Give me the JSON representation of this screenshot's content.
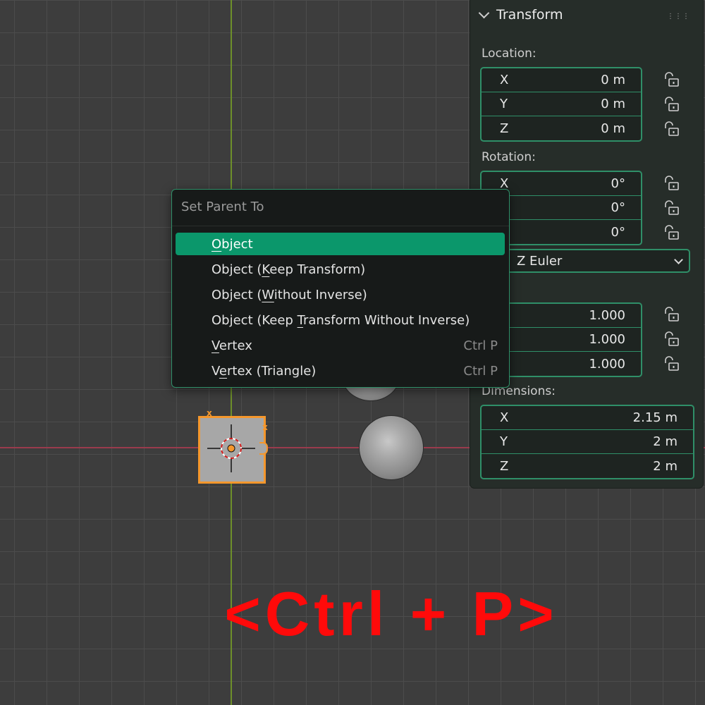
{
  "viewport": {
    "axis_colors": {
      "x": "#9a3b4d",
      "y": "#6d8f2a"
    },
    "selection_color": "#f5972c",
    "empty_marker_labels": [
      "x",
      "x"
    ]
  },
  "panel": {
    "title": "Transform",
    "location": {
      "label": "Location:",
      "rows": [
        {
          "axis": "X",
          "value": "0 m"
        },
        {
          "axis": "Y",
          "value": "0 m"
        },
        {
          "axis": "Z",
          "value": "0 m"
        }
      ]
    },
    "rotation": {
      "label": "Rotation:",
      "rows": [
        {
          "axis": "X",
          "value": "0°"
        },
        {
          "axis": "",
          "value": "0°"
        },
        {
          "axis": "",
          "value": "0°"
        }
      ],
      "mode": "Z Euler"
    },
    "scale": {
      "label": "e:",
      "rows": [
        {
          "axis": "",
          "value": "1.000"
        },
        {
          "axis": "",
          "value": "1.000"
        },
        {
          "axis": "",
          "value": "1.000"
        }
      ]
    },
    "dimensions": {
      "label": "Dimensions:",
      "rows": [
        {
          "axis": "X",
          "value": "2.15 m"
        },
        {
          "axis": "Y",
          "value": "2 m"
        },
        {
          "axis": "Z",
          "value": "2 m"
        }
      ]
    }
  },
  "menu": {
    "title": "Set Parent To",
    "items": [
      {
        "label": "Object",
        "u_pre": "",
        "u_char": "O",
        "u_post": "bject",
        "shortcut": "",
        "active": true
      },
      {
        "label": "Object (Keep Transform)",
        "u_pre": "Object (",
        "u_char": "K",
        "u_post": "eep Transform)",
        "shortcut": ""
      },
      {
        "label": "Object (Without Inverse)",
        "u_pre": "Object (",
        "u_char": "W",
        "u_post": "ithout Inverse)",
        "shortcut": ""
      },
      {
        "label": "Object (Keep Transform Without Inverse)",
        "u_pre": "Object (Keep ",
        "u_char": "T",
        "u_post": "ransform Without Inverse)",
        "shortcut": ""
      },
      {
        "label": "Vertex",
        "u_pre": "",
        "u_char": "V",
        "u_post": "ertex",
        "shortcut": "Ctrl P"
      },
      {
        "label": "Vertex (Triangle)",
        "u_pre": "V",
        "u_char": "e",
        "u_post": "rtex (Triangle)",
        "shortcut": "Ctrl P"
      }
    ]
  },
  "caption": "<Ctrl + P>"
}
